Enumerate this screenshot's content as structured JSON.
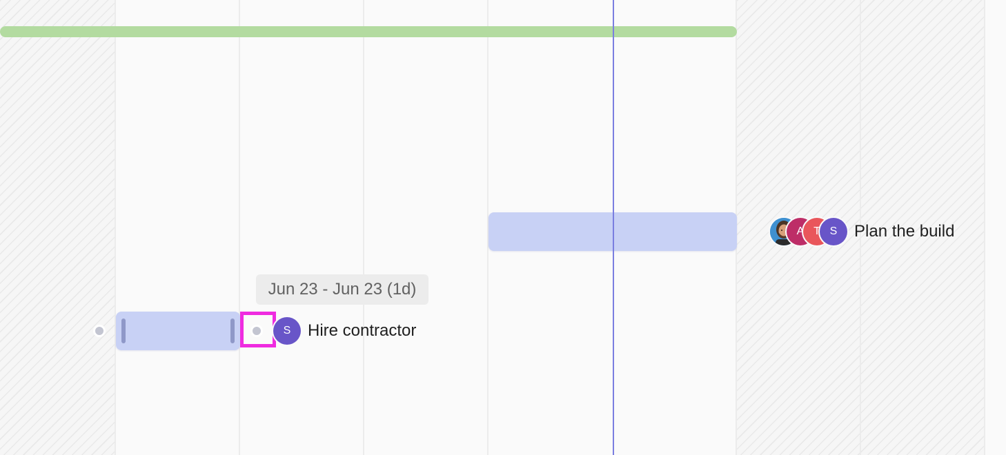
{
  "timeline": {
    "tooltip": {
      "date_range": "Jun 23 - Jun 23 (1d)"
    },
    "tasks": [
      {
        "name": "Plan the build",
        "assignees": [
          {
            "type": "photo",
            "icon": "person-photo-avatar"
          },
          {
            "initial": "A",
            "color": "#bd2d67"
          },
          {
            "initial": "T",
            "color": "#e9565b"
          },
          {
            "initial": "S",
            "color": "#6855c8"
          }
        ]
      },
      {
        "name": "Hire contractor",
        "assignees": [
          {
            "initial": "S",
            "color": "#6855c8"
          }
        ]
      }
    ]
  },
  "colors": {
    "milestone_bar": "#b3dba0",
    "task_bar": "#c8d1f5",
    "today_line": "#7a7ee0",
    "highlight": "#ef2be0"
  }
}
